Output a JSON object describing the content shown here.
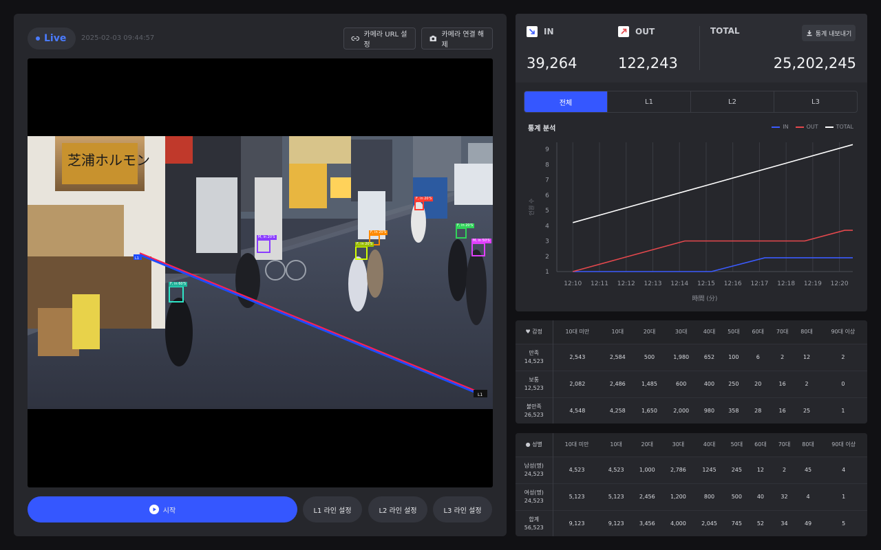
{
  "live": {
    "label": "Live",
    "timestamp": "2025-02-03 09:44:57"
  },
  "top_buttons": {
    "camera_url": "카메라 URL 설정",
    "camera_disconnect": "카메라 연결 해제"
  },
  "video": {
    "detections": [
      {
        "label": "M, in 20'S",
        "color": "#8a3cff"
      },
      {
        "label": "F, in 20'S",
        "color": "#ff8a00"
      },
      {
        "label": "F, in 20'S",
        "color": "#d4ff00"
      },
      {
        "label": "F, in 20'S",
        "color": "#ff3b30"
      },
      {
        "label": "F, in 20'S",
        "color": "#31d45a"
      },
      {
        "label": "M, in 50'S",
        "color": "#e040fb"
      },
      {
        "label": "F, in 60'S",
        "color": "#2ee6c8"
      }
    ],
    "line_label_start": "L1",
    "line_label_end": "L1"
  },
  "bottom_buttons": {
    "start": "시작",
    "l1": "L1 라인 설정",
    "l2": "L2 라인 설정",
    "l3": "L3 라인 설정"
  },
  "stats": {
    "in_label": "IN",
    "in_value": "39,264",
    "out_label": "OUT",
    "out_value": "122,243",
    "total_label": "TOTAL",
    "total_value": "25,202,245",
    "export_label": "통계 내보내기"
  },
  "tabs": [
    "전체",
    "L1",
    "L2",
    "L3"
  ],
  "chart_title": "통계 분석",
  "colors": {
    "in": "#3b5bff",
    "out": "#e5484d",
    "total": "#ffffff",
    "accent": "#3557ff"
  },
  "chart_data": {
    "type": "line",
    "x": [
      "12:10",
      "12:11",
      "12:12",
      "12:13",
      "12:14",
      "12:15",
      "12:16",
      "12:17",
      "12:18",
      "12:19",
      "12:20"
    ],
    "xlabel": "時間 (分)",
    "ylabel": "인원 수",
    "ylim": [
      1,
      9
    ],
    "yticks": [
      1,
      2,
      3,
      4,
      5,
      6,
      7,
      8,
      9
    ],
    "grid": "vertical",
    "legend": "top-right",
    "series": [
      {
        "name": "IN",
        "color": "#3b5bff",
        "x": [
          0,
          5.2,
          7.2,
          10.5
        ],
        "values": [
          1,
          1,
          1.9,
          1.9
        ]
      },
      {
        "name": "OUT",
        "color": "#e5484d",
        "x": [
          0,
          4.2,
          8.7,
          10.2,
          10.5
        ],
        "values": [
          1,
          3,
          3,
          3.7,
          3.7
        ]
      },
      {
        "name": "TOTAL",
        "color": "#ffffff",
        "x": [
          0,
          10.5
        ],
        "values": [
          4.2,
          9.3
        ]
      }
    ]
  },
  "emotion_table": {
    "header_label": "감정",
    "columns": [
      "10대 미만",
      "10대",
      "20대",
      "30대",
      "40대",
      "50대",
      "60대",
      "70대",
      "80대",
      "90대 이상"
    ],
    "rows": [
      {
        "name": "만족",
        "total": "14,523",
        "values": [
          "2,543",
          "2,584",
          "500",
          "1,980",
          "652",
          "100",
          "6",
          "2",
          "12",
          "2"
        ]
      },
      {
        "name": "보통",
        "total": "12,523",
        "values": [
          "2,082",
          "2,486",
          "1,485",
          "600",
          "400",
          "250",
          "20",
          "16",
          "2",
          "0"
        ]
      },
      {
        "name": "불만족",
        "total": "26,523",
        "values": [
          "4,548",
          "4,258",
          "1,650",
          "2,000",
          "980",
          "358",
          "28",
          "16",
          "25",
          "1"
        ]
      }
    ]
  },
  "gender_table": {
    "header_label": "성별",
    "columns": [
      "10대 미만",
      "10대",
      "20대",
      "30대",
      "40대",
      "50대",
      "60대",
      "70대",
      "80대",
      "90대 이상"
    ],
    "rows": [
      {
        "name": "남성(명)",
        "total": "24,523",
        "values": [
          "4,523",
          "4,523",
          "1,000",
          "2,786",
          "1245",
          "245",
          "12",
          "2",
          "45",
          "4"
        ]
      },
      {
        "name": "여성(명)",
        "total": "24,523",
        "values": [
          "5,123",
          "5,123",
          "2,456",
          "1,200",
          "800",
          "500",
          "40",
          "32",
          "4",
          "1"
        ]
      },
      {
        "name": "합계",
        "total": "56,523",
        "values": [
          "9,123",
          "9,123",
          "3,456",
          "4,000",
          "2,045",
          "745",
          "52",
          "34",
          "49",
          "5"
        ]
      }
    ]
  }
}
